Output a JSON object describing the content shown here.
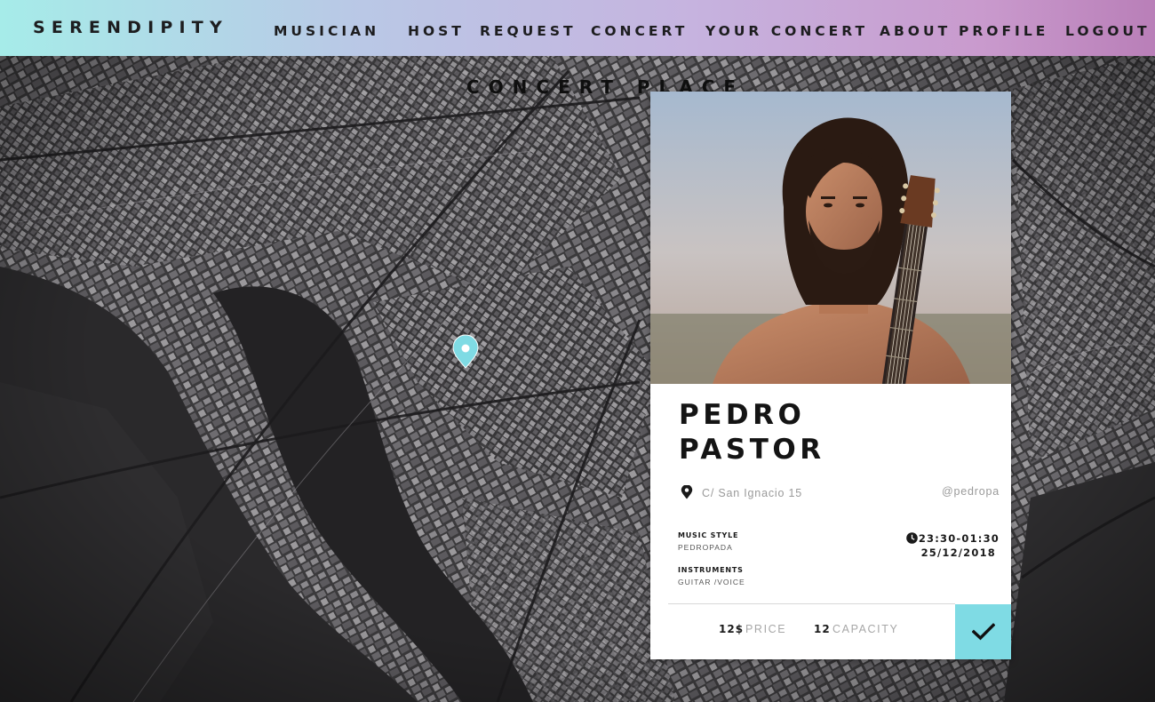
{
  "app": {
    "brand": "SERENDIPITY"
  },
  "nav": {
    "musician": "MUSICIAN",
    "host": "HOST",
    "request": "REQUEST",
    "concert": "CONCERT",
    "your_concert": "YOUR CONCERT",
    "about": "ABOUT",
    "profile": "PROFILE",
    "logout": "LOGOUT"
  },
  "page": {
    "title": "CONCERT PLACE"
  },
  "map": {
    "marker_icon": "location-pin-icon",
    "marker_color": "#7fdbe4"
  },
  "concert_card": {
    "first_name": "PEDRO",
    "last_name": "PASTOR",
    "address": "C/ San Ignacio 15",
    "handle": "@pedropa",
    "music_style_label": "MUSIC STYLE",
    "music_style": "PEDROPADA",
    "instruments_label": "INSTRUMENTS",
    "instruments": "GUITAR /VOICE",
    "time": "23:30-01:30",
    "date": "25/12/2018",
    "price": "12$",
    "price_label": "PRICE",
    "capacity": "12",
    "capacity_label": "CAPACITY",
    "confirm_icon": "checkmark-icon",
    "accent_color": "#7fdbe4"
  }
}
